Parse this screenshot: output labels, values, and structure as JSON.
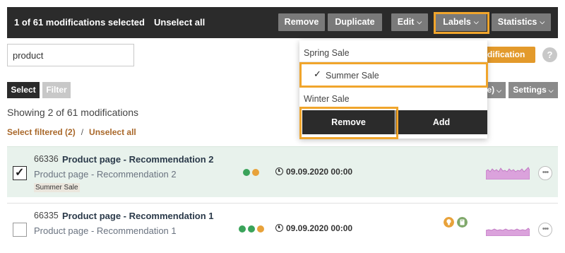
{
  "topbar": {
    "selection_text": "1 of 61 modifications selected",
    "unselect_all": "Unselect all",
    "remove": "Remove",
    "duplicate": "Duplicate",
    "edit": "Edit",
    "labels": "Labels",
    "statistics": "Statistics"
  },
  "search": {
    "value": "product"
  },
  "toolbar": {
    "new_modification": "odification",
    "help": "?",
    "select": "Select",
    "filter": "Filter",
    "sort_partial": "e)",
    "settings": "Settings"
  },
  "list_info": {
    "showing": "Showing 2 of 61 modifications",
    "select_filtered": "Select filtered (2)",
    "separator": "/",
    "unselect_all": "Unselect all"
  },
  "labels_menu": {
    "items": [
      {
        "label": "Spring Sale",
        "checked": false
      },
      {
        "label": "Summer Sale",
        "checked": true
      },
      {
        "label": "Winter Sale",
        "checked": false
      }
    ],
    "check_mark": "✓",
    "remove": "Remove",
    "add": "Add"
  },
  "rows": [
    {
      "id": "66336",
      "title": "Product page - Recommendation 2",
      "subtitle": "Product page - Recommendation 2",
      "tag": "Summer Sale",
      "selected": true,
      "check_mark": "✓",
      "status_dots": [
        "#3aa35a",
        "#e8a23a"
      ],
      "date": "09.09.2020 00:00",
      "more": "•••"
    },
    {
      "id": "66335",
      "title": "Product page - Recommendation 1",
      "subtitle": "Product page - Recommendation 1",
      "selected": false,
      "status_dots": [
        "#3aa35a",
        "#3aa35a",
        "#e8a23a"
      ],
      "date": "09.09.2020 00:00",
      "icons": [
        "lightbulb-icon",
        "sd-card-icon"
      ],
      "more": "•••"
    }
  ],
  "colors": {
    "accent": "#e39a2b",
    "highlight": "#f0a52c",
    "dark": "#2b2b2b",
    "selected_row": "#e8f2ec",
    "sparkline": "#c27bc4"
  }
}
